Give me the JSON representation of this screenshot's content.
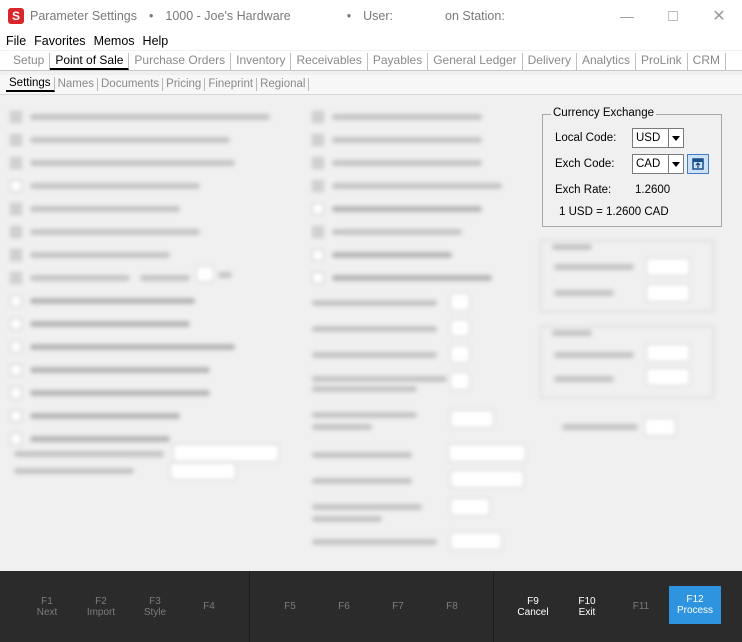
{
  "window": {
    "app_icon": "S",
    "title": "Parameter Settings",
    "store": "1000 - Joe's Hardware",
    "user_label": "User:",
    "station_label": "on Station:"
  },
  "menu": [
    "File",
    "Favorites",
    "Memos",
    "Help"
  ],
  "top_tabs": [
    "Setup",
    "Point of Sale",
    "Purchase Orders",
    "Inventory",
    "Receivables",
    "Payables",
    "General Ledger",
    "Delivery",
    "Analytics",
    "ProLink",
    "CRM"
  ],
  "top_tabs_active": "Point of Sale",
  "sub_tabs": [
    "Settings",
    "Names",
    "Documents",
    "Pricing",
    "Fineprint",
    "Regional"
  ],
  "sub_tabs_active": "Settings",
  "currency_exchange": {
    "legend": "Currency Exchange",
    "local_code_label": "Local Code:",
    "local_code_value": "USD",
    "exch_code_label": "Exch Code:",
    "exch_code_value": "CAD",
    "exch_rate_label": "Exch Rate:",
    "exch_rate_value": "1.2600",
    "conversion_text": "1 USD = 1.2600 CAD"
  },
  "function_keys": [
    {
      "key": "F1",
      "label": "Next"
    },
    {
      "key": "F2",
      "label": "Import"
    },
    {
      "key": "F3",
      "label": "Style"
    },
    {
      "key": "F4",
      "label": ""
    },
    {
      "key": "F5",
      "label": ""
    },
    {
      "key": "F6",
      "label": ""
    },
    {
      "key": "F7",
      "label": ""
    },
    {
      "key": "F8",
      "label": ""
    },
    {
      "key": "F9",
      "label": "Cancel"
    },
    {
      "key": "F10",
      "label": "Exit"
    },
    {
      "key": "F11",
      "label": ""
    },
    {
      "key": "F12",
      "label": "Process"
    }
  ],
  "colors": {
    "process_accent": "#2f94e0",
    "app_icon": "#d9262b",
    "function_bar": "#2b2b2b"
  }
}
